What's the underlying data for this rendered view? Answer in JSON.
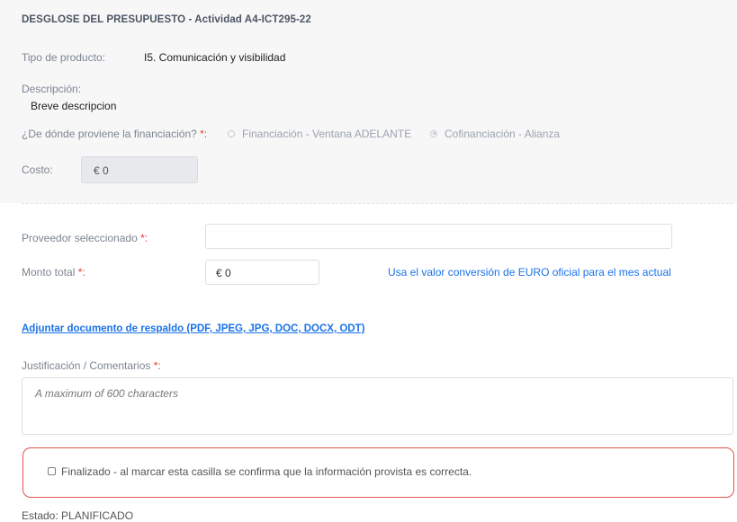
{
  "header": {
    "title": "DESGLOSE DEL PRESUPUESTO - Actividad A4-ICT295-22"
  },
  "product": {
    "label": "Tipo de producto:",
    "value": "I5. Comunicación y visibilidad"
  },
  "description": {
    "label": "Descripción:",
    "value": "Breve descripcion"
  },
  "funding": {
    "label": "¿De dónde proviene la financiación?",
    "required_mark": "*:",
    "options": [
      {
        "label": "Financiación - Ventana ADELANTE",
        "selected": false
      },
      {
        "label": "Cofinanciación - Alianza",
        "selected": true
      }
    ]
  },
  "cost": {
    "label": "Costo:",
    "value": "€ 0"
  },
  "provider": {
    "label": "Proveedor seleccionado",
    "required_mark": "*:",
    "value": ""
  },
  "total": {
    "label": "Monto total",
    "required_mark": "*:",
    "value": "€ 0",
    "conversion_link": "Usa el valor conversión de EURO oficial para el mes actual"
  },
  "attachment": {
    "link_text": "Adjuntar documento de respaldo (PDF, JPEG, JPG, DOC, DOCX, ODT)"
  },
  "justification": {
    "label": "Justificación / Comentarios",
    "required_mark": "*:",
    "placeholder": "A maximum of 600 characters",
    "value": ""
  },
  "confirmation": {
    "label": "Finalizado - al marcar esta casilla se confirma que la información provista es correcta.",
    "checked": false
  },
  "status": {
    "text": "Estado: PLANIFICADO"
  }
}
